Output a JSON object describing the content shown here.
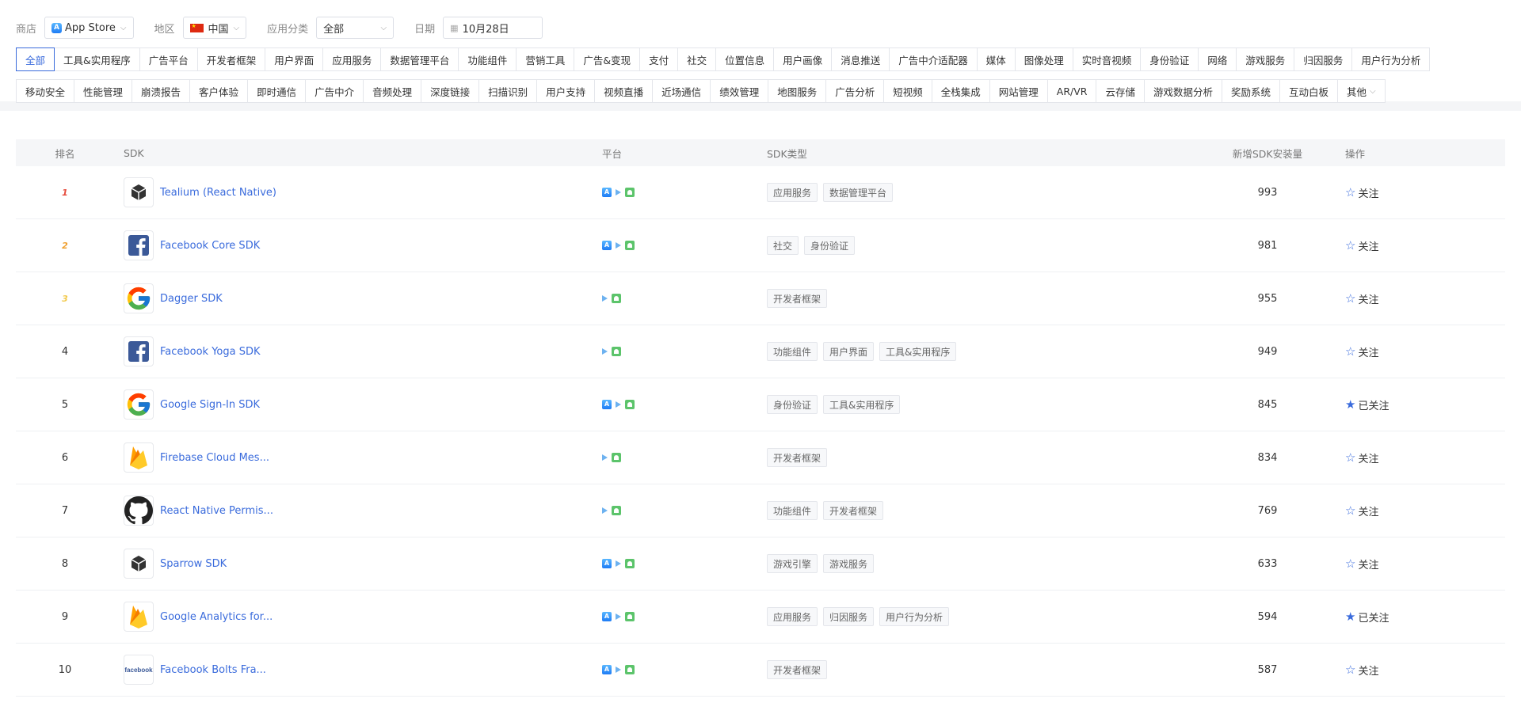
{
  "filters": {
    "store_label": "商店",
    "store_value": "App Store",
    "region_label": "地区",
    "region_value": "中国",
    "category_label": "应用分类",
    "category_value": "全部",
    "date_label": "日期",
    "date_value": "10月28日"
  },
  "chips_row1": [
    "全部",
    "工具&实用程序",
    "广告平台",
    "开发者框架",
    "用户界面",
    "应用服务",
    "数据管理平台",
    "功能组件",
    "营销工具",
    "广告&变现",
    "支付",
    "社交",
    "位置信息",
    "用户画像",
    "消息推送",
    "广告中介适配器",
    "媒体",
    "图像处理",
    "实时音视频",
    "身份验证",
    "网络",
    "游戏服务",
    "归因服务",
    "用户行为分析"
  ],
  "chips_row2": [
    "移动安全",
    "性能管理",
    "崩溃报告",
    "客户体验",
    "即时通信",
    "广告中介",
    "音频处理",
    "深度链接",
    "扫描识别",
    "用户支持",
    "视频直播",
    "近场通信",
    "绩效管理",
    "地图服务",
    "广告分析",
    "短视频",
    "全栈集成",
    "网站管理",
    "AR/VR",
    "云存储",
    "游戏数据分析",
    "奖励系统",
    "互动白板",
    "其他"
  ],
  "table": {
    "headers": {
      "rank": "排名",
      "sdk": "SDK",
      "platform": "平台",
      "type": "SDK类型",
      "installs": "新增SDK安装量",
      "action": "操作"
    },
    "rows": [
      {
        "rank": "1",
        "name": "Tealium (React Native)",
        "logo": "box-icon",
        "platforms": [
          "ios",
          "gp",
          "android"
        ],
        "tags": [
          "应用服务",
          "数据管理平台"
        ],
        "installs": "993",
        "action": "关注",
        "followed": false
      },
      {
        "rank": "2",
        "name": "Facebook Core SDK",
        "logo": "facebook-icon",
        "platforms": [
          "ios",
          "gp",
          "android"
        ],
        "tags": [
          "社交",
          "身份验证"
        ],
        "installs": "981",
        "action": "关注",
        "followed": false
      },
      {
        "rank": "3",
        "name": "Dagger SDK",
        "logo": "google-icon",
        "platforms": [
          "gp",
          "android"
        ],
        "tags": [
          "开发者框架"
        ],
        "installs": "955",
        "action": "关注",
        "followed": false
      },
      {
        "rank": "4",
        "name": "Facebook Yoga SDK",
        "logo": "facebook-icon",
        "platforms": [
          "gp",
          "android"
        ],
        "tags": [
          "功能组件",
          "用户界面",
          "工具&实用程序"
        ],
        "installs": "949",
        "action": "关注",
        "followed": false
      },
      {
        "rank": "5",
        "name": "Google Sign-In SDK",
        "logo": "google-icon",
        "platforms": [
          "ios",
          "gp",
          "android"
        ],
        "tags": [
          "身份验证",
          "工具&实用程序"
        ],
        "installs": "845",
        "action": "已关注",
        "followed": true
      },
      {
        "rank": "6",
        "name": "Firebase Cloud Mes...",
        "logo": "firebase-icon",
        "platforms": [
          "gp",
          "android"
        ],
        "tags": [
          "开发者框架"
        ],
        "installs": "834",
        "action": "关注",
        "followed": false
      },
      {
        "rank": "7",
        "name": "React Native Permis...",
        "logo": "github-icon",
        "platforms": [
          "gp",
          "android"
        ],
        "tags": [
          "功能组件",
          "开发者框架"
        ],
        "installs": "769",
        "action": "关注",
        "followed": false
      },
      {
        "rank": "8",
        "name": "Sparrow SDK",
        "logo": "box-icon",
        "platforms": [
          "ios",
          "gp",
          "android"
        ],
        "tags": [
          "游戏引擎",
          "游戏服务"
        ],
        "installs": "633",
        "action": "关注",
        "followed": false
      },
      {
        "rank": "9",
        "name": "Google Analytics for...",
        "logo": "firebase-icon",
        "platforms": [
          "ios",
          "gp",
          "android"
        ],
        "tags": [
          "应用服务",
          "归因服务",
          "用户行为分析"
        ],
        "installs": "594",
        "action": "已关注",
        "followed": true
      },
      {
        "rank": "10",
        "name": "Facebook Bolts Fra...",
        "logo": "facebook-wordmark-icon",
        "platforms": [
          "ios",
          "gp",
          "android"
        ],
        "tags": [
          "开发者框架"
        ],
        "installs": "587",
        "action": "关注",
        "followed": false
      }
    ]
  },
  "colors": {
    "accent": "#3a6bdc",
    "medal_1": "#e64b3c",
    "medal_2": "#f0a030",
    "medal_3": "#f2c94c"
  }
}
